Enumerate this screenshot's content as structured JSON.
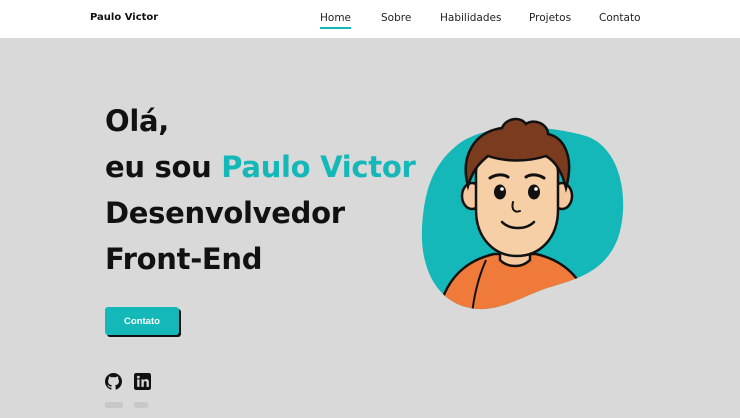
{
  "header": {
    "brand": "Paulo Victor",
    "nav": [
      "Home",
      "Sobre",
      "Habilidades",
      "Projetos",
      "Contato"
    ],
    "active": "Home"
  },
  "hero": {
    "greeting": "Olá,",
    "intro_prefix": "eu sou ",
    "name": "Paulo Victor",
    "role_line1": "Desenvolvedor",
    "role_line2": "Front-End",
    "cta_label": "Contato"
  },
  "social": {
    "icons": [
      "github-icon",
      "linkedin-icon"
    ]
  },
  "colors": {
    "accent": "#14b8b8",
    "background": "#d9d9d9",
    "header": "#ffffff",
    "text": "#111111",
    "shirt": "#f07a3a"
  }
}
